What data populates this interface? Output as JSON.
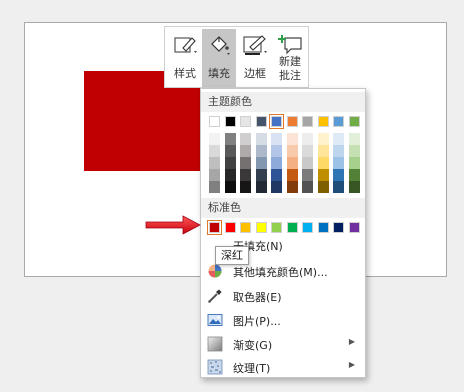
{
  "toolbar": {
    "buttons": [
      {
        "label": "样式",
        "icon": "style-pen-icon"
      },
      {
        "label": "填充",
        "icon": "paint-bucket-icon"
      },
      {
        "label": "边框",
        "icon": "border-pen-icon"
      },
      {
        "label_line1": "新建",
        "label_line2": "批注",
        "icon": "new-comment-icon"
      }
    ]
  },
  "dropdown": {
    "theme_colors_title": "主题颜色",
    "standard_colors_title": "标准色",
    "theme_row": [
      "#ffffff",
      "#000000",
      "#e7e6e6",
      "#44546a",
      "#4472c4",
      "#ed7d31",
      "#a5a5a5",
      "#ffc000",
      "#5b9bd5",
      "#70ad47"
    ],
    "theme_shades": [
      [
        "#f2f2f2",
        "#d9d9d9",
        "#bfbfbf",
        "#a6a6a6",
        "#808080"
      ],
      [
        "#808080",
        "#595959",
        "#404040",
        "#262626",
        "#0d0d0d"
      ],
      [
        "#d0cece",
        "#aeaaaa",
        "#757171",
        "#3a3838",
        "#171616"
      ],
      [
        "#d6dce4",
        "#adb9ca",
        "#8497b0",
        "#333f4f",
        "#222a35"
      ],
      [
        "#d9e2f3",
        "#b4c6e7",
        "#8eaadb",
        "#2f5496",
        "#1f3864"
      ],
      [
        "#fbe4d5",
        "#f7caac",
        "#f4b083",
        "#c45911",
        "#823b0b"
      ],
      [
        "#ededed",
        "#dbdbdb",
        "#c9c9c9",
        "#7b7b7b",
        "#525252"
      ],
      [
        "#fff2cc",
        "#fee599",
        "#ffd965",
        "#bf8f00",
        "#7f6000"
      ],
      [
        "#deeaf6",
        "#bdd6ee",
        "#9cc2e5",
        "#2e75b5",
        "#1e4e79"
      ],
      [
        "#e2efd9",
        "#c5e0b3",
        "#a8d08d",
        "#538135",
        "#375623"
      ]
    ],
    "standard_colors": [
      "#c00000",
      "#ff0000",
      "#ffc000",
      "#ffff00",
      "#92d050",
      "#00b050",
      "#00b0f0",
      "#0070c0",
      "#002060",
      "#7030a0"
    ],
    "menu_items": [
      {
        "label": "无填充(N)",
        "icon": "no-fill-icon",
        "has_submenu": false
      },
      {
        "label": "其他填充颜色(M)...",
        "icon": "color-wheel-icon",
        "has_submenu": false
      },
      {
        "label": "取色器(E)",
        "icon": "eyedropper-icon",
        "has_submenu": false
      },
      {
        "label": "图片(P)...",
        "icon": "picture-icon",
        "has_submenu": false
      },
      {
        "label": "渐变(G)",
        "icon": "gradient-icon",
        "has_submenu": true
      },
      {
        "label": "纹理(T)",
        "icon": "texture-icon",
        "has_submenu": true
      }
    ]
  },
  "tooltip": {
    "text": "深红"
  },
  "colors": {
    "slide_shape": "#c00000",
    "pointer_arrow": "#e0151f",
    "selection_outline": "#e07a2a"
  }
}
